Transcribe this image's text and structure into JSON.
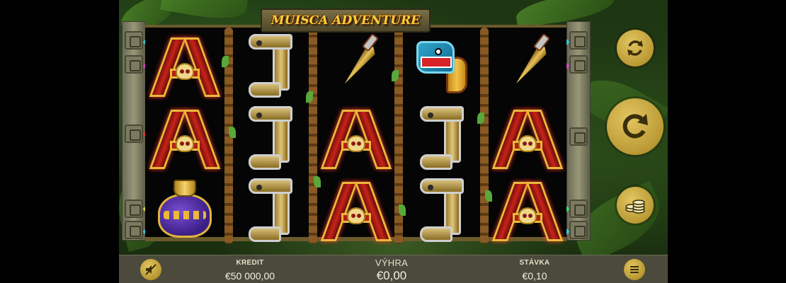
{
  "game": {
    "title": "MUISCA ADVENTURE"
  },
  "reels": {
    "columns": [
      [
        "A-symbol",
        "A-symbol",
        "vase-symbol"
      ],
      [
        "J-symbol",
        "J-symbol",
        "J-symbol"
      ],
      [
        "dagger-symbol",
        "A-symbol",
        "A-symbol"
      ],
      [
        "serpent-symbol",
        "J-symbol",
        "J-symbol"
      ],
      [
        "dagger-symbol",
        "A-symbol",
        "A-symbol"
      ]
    ]
  },
  "controls": {
    "autoplay_icon": "autoplay-icon",
    "spin_icon": "spin-icon",
    "bet_icon": "coins-icon",
    "sound_icon": "sound-muted-icon",
    "menu_icon": "menu-icon"
  },
  "stats": {
    "credit_label": "KREDIT",
    "credit_value": "€50 000,00",
    "win_label": "VÝHRA",
    "win_value": "€0,00",
    "bet_label": "STÁVKA",
    "bet_value": "€0,10"
  },
  "colors": {
    "accent_gold": "#d4b64a",
    "bar_bg": "#4b4a3c"
  }
}
